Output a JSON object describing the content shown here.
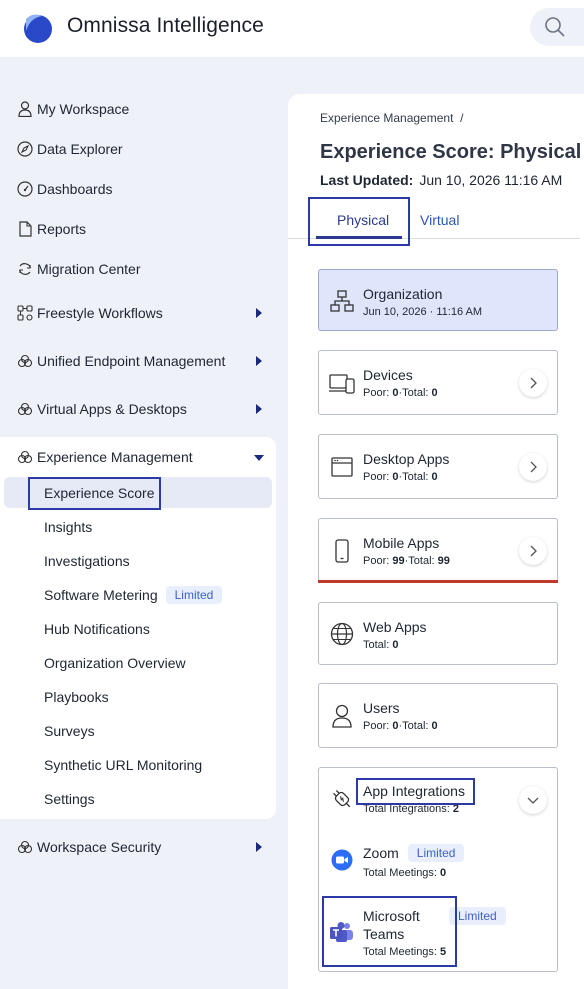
{
  "app": {
    "title": "Omnissa Intelligence"
  },
  "colors": {
    "accent": "#2b3a8f",
    "selected_bg": "#dfe5fa",
    "alert": "#c0392b",
    "badge_text": "#3d62c2"
  },
  "sidebar": {
    "items": [
      {
        "label": "My Workspace",
        "icon": "person-icon"
      },
      {
        "label": "Data Explorer",
        "icon": "compass-icon"
      },
      {
        "label": "Dashboards",
        "icon": "gauge-icon"
      },
      {
        "label": "Reports",
        "icon": "document-icon"
      },
      {
        "label": "Migration Center",
        "icon": "refresh-icon"
      },
      {
        "label": "Freestyle Workflows",
        "icon": "workflow-icon"
      },
      {
        "label": "Unified Endpoint Management",
        "icon": "cloud-icon"
      },
      {
        "label": "Virtual Apps & Desktops",
        "icon": "cloud-icon"
      },
      {
        "label": "Experience Management",
        "icon": "cloud-icon"
      },
      {
        "label": "Workspace Security",
        "icon": "cloud-icon"
      }
    ],
    "sub_items": [
      {
        "label": "Experience Score"
      },
      {
        "label": "Insights"
      },
      {
        "label": "Investigations"
      },
      {
        "label": "Software Metering",
        "badge": "Limited"
      },
      {
        "label": "Hub Notifications"
      },
      {
        "label": "Organization Overview"
      },
      {
        "label": "Playbooks"
      },
      {
        "label": "Surveys"
      },
      {
        "label": "Synthetic URL Monitoring"
      },
      {
        "label": "Settings"
      }
    ]
  },
  "main": {
    "breadcrumb": "Experience Management  /",
    "title": "Experience Score: Physical",
    "last_updated_label": "Last Updated:",
    "last_updated_value": "Jun 10, 2026 11:16 AM",
    "tabs": [
      {
        "label": "Physical"
      },
      {
        "label": "Virtual"
      }
    ],
    "cards": {
      "organization": {
        "title": "Organization",
        "sub": "Jun 10, 2026 · 11:16 AM"
      },
      "devices": {
        "title": "Devices",
        "poor_label": "Poor:",
        "poor": "0",
        "total_label": "·Total:",
        "total": "0"
      },
      "desktop": {
        "title": "Desktop Apps",
        "poor_label": "Poor:",
        "poor": "0",
        "total_label": "·Total:",
        "total": "0"
      },
      "mobile": {
        "title": "Mobile Apps",
        "poor_label": "Poor:",
        "poor": "99",
        "total_label": "·Total:",
        "total": "99"
      },
      "web": {
        "title": "Web Apps",
        "total_label": "Total:",
        "total": "0"
      },
      "users": {
        "title": "Users",
        "poor_label": "Poor:",
        "poor": "0",
        "total_label": "·Total:",
        "total": "0"
      },
      "integrations": {
        "title": "App Integrations",
        "total_label": "Total Integrations:",
        "total": "2",
        "zoom": {
          "title": "Zoom",
          "badge": "Limited",
          "meet_label": "Total Meetings:",
          "meet": "0"
        },
        "teams": {
          "title_line1": "Microsoft",
          "title_line2": "Teams",
          "badge": "Limited",
          "meet_label": "Total Meetings:",
          "meet": "5"
        }
      }
    }
  }
}
